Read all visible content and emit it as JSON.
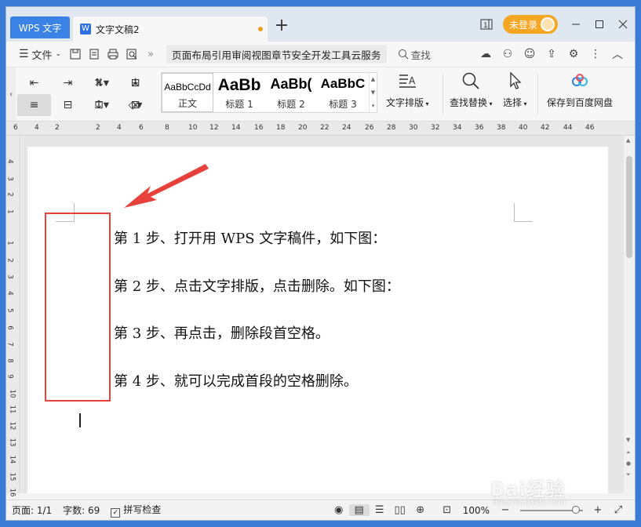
{
  "titlebar": {
    "app_tab": "WPS 文字",
    "doc_tab": "文字文稿2",
    "doc_icon": "W",
    "new_tab": "+",
    "login": "未登录",
    "icons": [
      "window-mode-icon",
      "minimize-icon",
      "maximize-icon",
      "close-icon"
    ]
  },
  "menubar": {
    "file": "文件",
    "tabs_text": "页面布局引用审阅视图章节安全开发工具云服务",
    "search": "查找"
  },
  "ribbon": {
    "styles": [
      {
        "sample": "AaBbCcDd",
        "name": "正文"
      },
      {
        "sample": "AaBb",
        "name": "标题 1"
      },
      {
        "sample": "AaBb(",
        "name": "标题 2"
      },
      {
        "sample": "AaBbC",
        "name": "标题 3"
      }
    ],
    "typeset": "文字排版",
    "find_replace": "查找替换",
    "select": "选择",
    "save_baidu": "保存到百度网盘"
  },
  "ruler": {
    "h_ticks": [
      "6",
      "4",
      "2",
      "2",
      "4",
      "6",
      "8",
      "10",
      "12",
      "14",
      "16",
      "18",
      "20",
      "22",
      "24",
      "26",
      "28",
      "30",
      "32",
      "34",
      "36",
      "38",
      "40",
      "42",
      "44",
      "46"
    ],
    "v_ticks": [
      "4",
      "3",
      "2",
      "1",
      "1",
      "2",
      "3",
      "4",
      "5",
      "6",
      "7",
      "8",
      "9",
      "10",
      "11",
      "12",
      "13",
      "14",
      "15",
      "16"
    ]
  },
  "document": {
    "paragraphs": [
      "第 1 步、打开用 WPS 文字稿件，如下图：",
      "第 2 步、点击文字排版，点击删除。如下图：",
      "第 3 步、再点击，删除段首空格。",
      "第 4 步、就可以完成首段的空格删除。"
    ]
  },
  "statusbar": {
    "page": "页面: 1/1",
    "words": "字数: 69",
    "spellcheck": "拼写检查",
    "zoom": "100%"
  },
  "watermark": {
    "main": "Bai经验",
    "sub": "jingyan.baidu.com"
  },
  "colors": {
    "accent": "#3b82e6",
    "login": "#f5a623",
    "annotation": "#e8403b"
  }
}
